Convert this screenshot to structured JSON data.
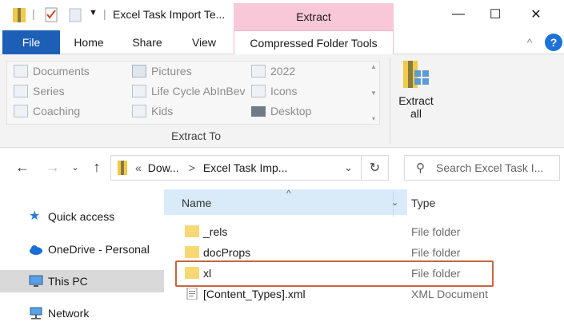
{
  "window": {
    "title": "Excel Task Import Te...",
    "contextual_tab_title": "Extract",
    "buttons": {
      "minimize": "—",
      "maximize": "☐",
      "close": "✕"
    }
  },
  "ribbon_tabs": {
    "file": "File",
    "home": "Home",
    "share": "Share",
    "view": "View",
    "compressed": "Compressed Folder Tools",
    "collapse": "^",
    "help": "?"
  },
  "ribbon": {
    "gallery_items": [
      "Documents",
      "Pictures",
      "2022",
      "Series",
      "Life Cycle AbInBev",
      "Icons",
      "Coaching",
      "Kids",
      "Desktop"
    ],
    "group_label": "Extract To",
    "extract_all_line1": "Extract",
    "extract_all_line2": "all"
  },
  "address": {
    "chevron_prefix": "«",
    "crumbs": [
      "Dow...",
      "Excel Task Imp..."
    ],
    "separator": ">",
    "search_placeholder": "Search Excel Task I..."
  },
  "nav_pane": {
    "items": [
      "Quick access",
      "OneDrive - Personal",
      "This PC",
      "Network"
    ]
  },
  "file_list": {
    "columns": {
      "name": "Name",
      "type": "Type"
    },
    "rows": [
      {
        "name": "_rels",
        "type": "File folder"
      },
      {
        "name": "docProps",
        "type": "File folder"
      },
      {
        "name": "xl",
        "type": "File folder"
      },
      {
        "name": "[Content_Types].xml",
        "type": "XML Document"
      }
    ]
  },
  "colors": {
    "accent": "#1d5fb6",
    "extract_tab": "#f8c8d8",
    "highlight_box": "#c8643e",
    "folder": "#f8d775"
  }
}
